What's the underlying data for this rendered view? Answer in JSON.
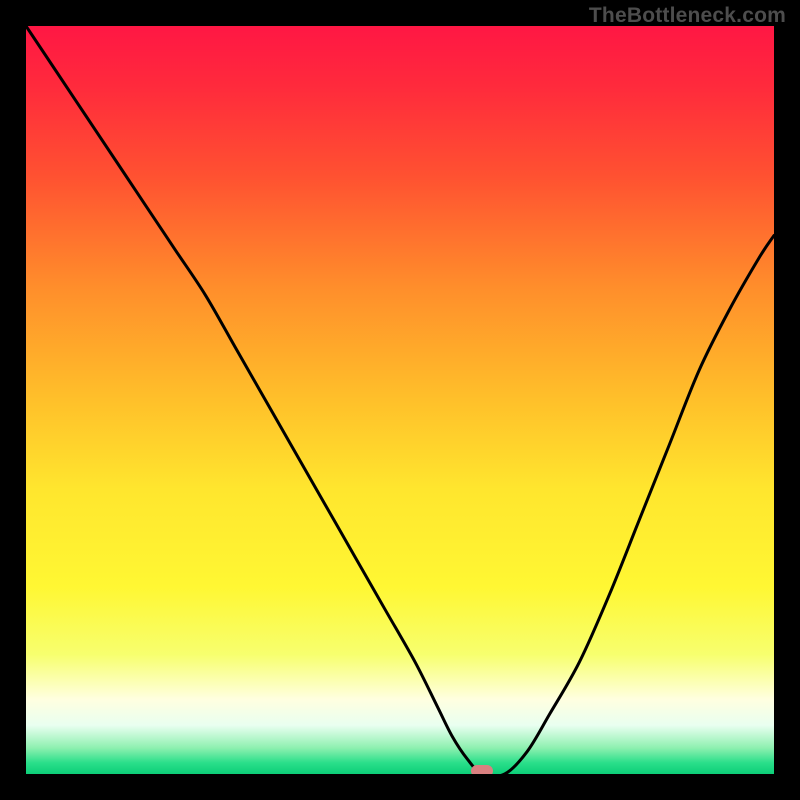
{
  "watermark": "TheBottleneck.com",
  "chart_data": {
    "type": "line",
    "title": "",
    "xlabel": "",
    "ylabel": "",
    "xlim": [
      0,
      100
    ],
    "ylim": [
      0,
      100
    ],
    "grid": false,
    "legend": false,
    "background_gradient": {
      "stops": [
        {
          "offset": 0.0,
          "color": "#ff1744"
        },
        {
          "offset": 0.08,
          "color": "#ff2a3c"
        },
        {
          "offset": 0.2,
          "color": "#ff5131"
        },
        {
          "offset": 0.35,
          "color": "#ff8e2b"
        },
        {
          "offset": 0.5,
          "color": "#ffc02a"
        },
        {
          "offset": 0.62,
          "color": "#ffe62e"
        },
        {
          "offset": 0.75,
          "color": "#fff733"
        },
        {
          "offset": 0.84,
          "color": "#f7ff6e"
        },
        {
          "offset": 0.9,
          "color": "#ffffe0"
        },
        {
          "offset": 0.935,
          "color": "#e9fff0"
        },
        {
          "offset": 0.965,
          "color": "#8ef0b0"
        },
        {
          "offset": 0.985,
          "color": "#2adf8a"
        },
        {
          "offset": 1.0,
          "color": "#0cce78"
        }
      ]
    },
    "series": [
      {
        "name": "bottleneck-curve",
        "color": "#000000",
        "x": [
          0,
          4,
          8,
          12,
          16,
          20,
          24,
          28,
          32,
          36,
          40,
          44,
          48,
          52,
          55,
          57,
          59,
          61,
          64,
          67,
          70,
          74,
          78,
          82,
          86,
          90,
          94,
          98,
          100
        ],
        "y": [
          100,
          94,
          88,
          82,
          76,
          70,
          64,
          57,
          50,
          43,
          36,
          29,
          22,
          15,
          9,
          5,
          2,
          0,
          0,
          3,
          8,
          15,
          24,
          34,
          44,
          54,
          62,
          69,
          72
        ]
      }
    ],
    "marker": {
      "x": 61,
      "y": 0,
      "color": "#d98080"
    }
  }
}
